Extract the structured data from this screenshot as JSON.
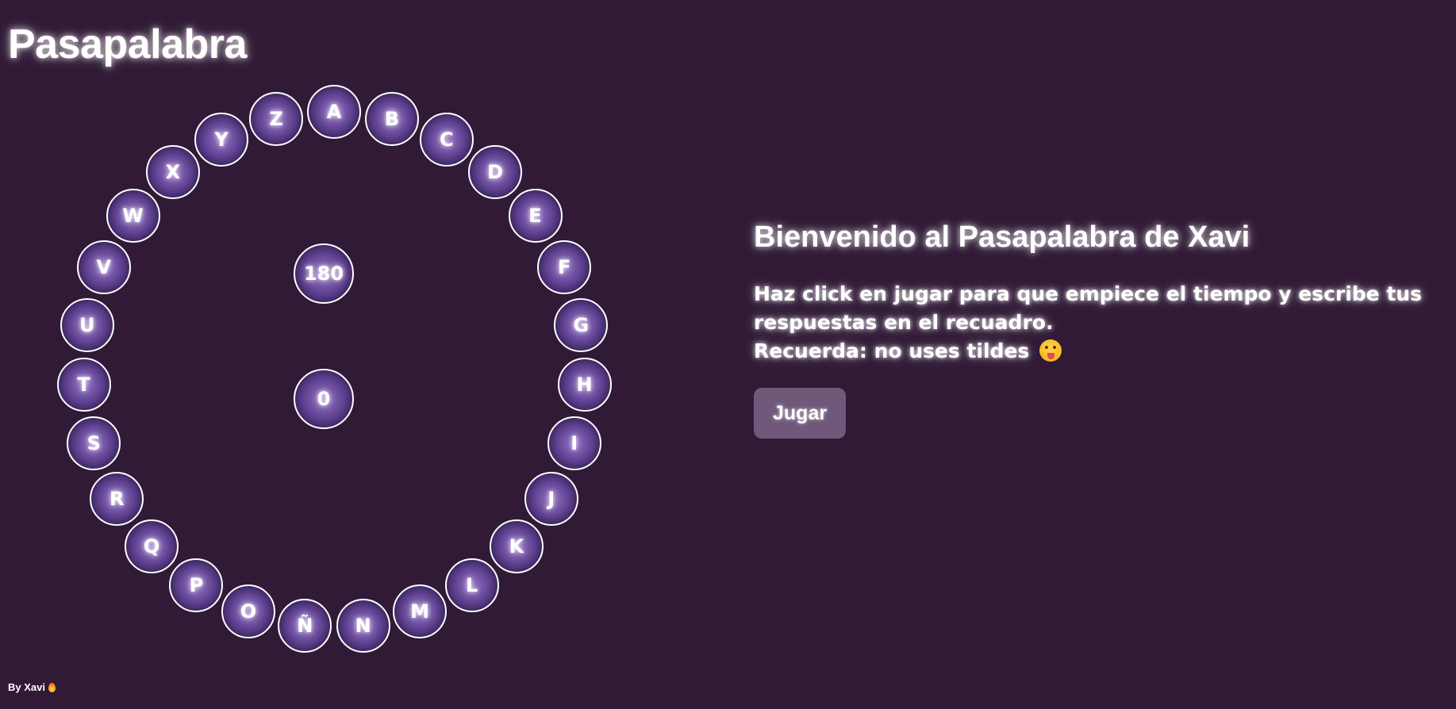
{
  "app": {
    "title": "Pasapalabra"
  },
  "rosco": {
    "letters": [
      "A",
      "B",
      "C",
      "D",
      "E",
      "F",
      "G",
      "H",
      "I",
      "J",
      "K",
      "L",
      "M",
      "N",
      "Ñ",
      "O",
      "P",
      "Q",
      "R",
      "S",
      "T",
      "U",
      "V",
      "W",
      "X",
      "Y",
      "Z"
    ],
    "timer": "180",
    "score": "0"
  },
  "welcome": {
    "heading": "Bienvenido al Pasapalabra de Xavi",
    "line1": "Haz click en jugar para que empiece el tiempo y escribe tus respuestas en el recuadro.",
    "line2": "Recuerda: no uses tildes",
    "emoji": "tongue-wink-emoji",
    "play_label": "Jugar"
  },
  "footer": {
    "credit": "By Xavi",
    "icon": "fire-icon"
  },
  "colors": {
    "background": "#301a36",
    "letter_fill": "#5d3f8f",
    "button": "#70587a"
  }
}
